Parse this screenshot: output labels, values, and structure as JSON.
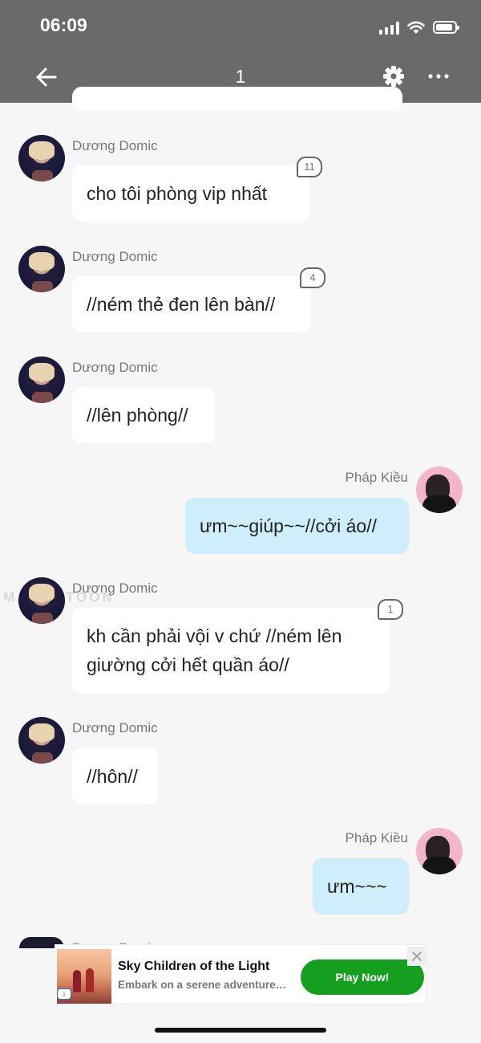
{
  "status_bar": {
    "time": "06:09"
  },
  "header": {
    "title": "1"
  },
  "messages": [
    {
      "sender": "Dương Domic",
      "text": "cho tôi phòng vip nhất",
      "count": "11"
    },
    {
      "sender": "Dương Domic",
      "text": "//ném thẻ đen lên bàn//",
      "count": "4"
    },
    {
      "sender": "Dương Domic",
      "text": "//lên phòng//"
    },
    {
      "sender": "Pháp Kiều",
      "text": "ưm~~giúp~~//cởi áo//"
    },
    {
      "sender": "Dương Domic",
      "text": "kh cần phải vội v chứ //ném lên giường cởi hết quần áo//",
      "count": "1"
    },
    {
      "sender": "Dương Domic",
      "text": "//hôn//"
    },
    {
      "sender": "Pháp Kiều",
      "text": "ưm~~~"
    },
    {
      "sender": "Dương Domic"
    }
  ],
  "watermark": "MANGATOON",
  "ad": {
    "title": "Sky Children of the Light",
    "description": "Embark on a serene adventure…",
    "cta": "Play Now!",
    "info_label": "i"
  },
  "icons": [
    "back-arrow-icon",
    "gear-icon",
    "more-icon",
    "signal-icon",
    "wifi-icon",
    "battery-icon",
    "close-icon"
  ],
  "colors": {
    "header_bg": "#6a6a6a",
    "my_bubble": "#cdeefa",
    "cta_green": "#14a01e"
  }
}
